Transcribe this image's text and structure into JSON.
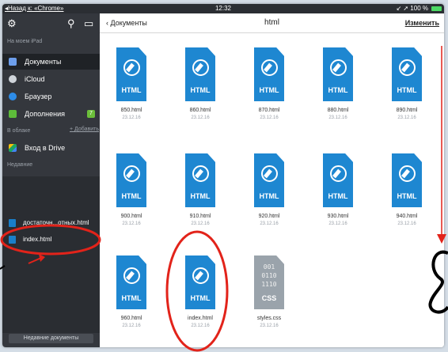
{
  "statusbar": {
    "back": "◂Назад к: «Chrome»",
    "time": "12:32",
    "right": "↙ ➚ 100 %"
  },
  "sidebar": {
    "on_ipad": "На моем iPad",
    "items": [
      {
        "label": "Документы",
        "icon": "document-icon",
        "color": "#6d9eeb"
      },
      {
        "label": "iCloud",
        "icon": "cloud-icon",
        "color": "#cfd4da"
      },
      {
        "label": "Браузер",
        "icon": "compass-icon",
        "color": "#2d8ce8"
      },
      {
        "label": "Дополнения",
        "icon": "cart-icon",
        "color": "#5dbb3a",
        "badge": "7"
      }
    ],
    "in_cloud": "В облаке",
    "add_link": "+ Добавить",
    "drive": "Вход в Drive",
    "recent_header": "Недавние",
    "recent": [
      "достаточн...отных.html",
      "index.html"
    ],
    "recent_button": "Недавние документы"
  },
  "topbar": {
    "back": "‹  Документы",
    "title": "html",
    "edit": "Изменить"
  },
  "files": [
    {
      "name": "850.html",
      "date": "23.12.16",
      "type": "HTML"
    },
    {
      "name": "860.html",
      "date": "23.12.16",
      "type": "HTML"
    },
    {
      "name": "870.html",
      "date": "23.12.16",
      "type": "HTML"
    },
    {
      "name": "880.html",
      "date": "23.12.16",
      "type": "HTML"
    },
    {
      "name": "890.html",
      "date": "23.12.16",
      "type": "HTML"
    },
    {
      "name": "900.html",
      "date": "23.12.16",
      "type": "HTML"
    },
    {
      "name": "910.html",
      "date": "23.12.16",
      "type": "HTML"
    },
    {
      "name": "920.html",
      "date": "23.12.16",
      "type": "HTML"
    },
    {
      "name": "930.html",
      "date": "23.12.16",
      "type": "HTML"
    },
    {
      "name": "940.html",
      "date": "23.12.16",
      "type": "HTML"
    },
    {
      "name": "960.html",
      "date": "23.12.16",
      "type": "HTML"
    },
    {
      "name": "index.html",
      "date": "23.12.16",
      "type": "HTML"
    },
    {
      "name": "styles.css",
      "date": "23.12.16",
      "type": "CSS",
      "lines": [
        "001",
        "0110",
        "1110"
      ]
    }
  ],
  "colors": {
    "html_file": "#1e87d1",
    "css_file": "#9aa3ab",
    "sidebar": "#34373d",
    "annotation": "#e2231a"
  }
}
